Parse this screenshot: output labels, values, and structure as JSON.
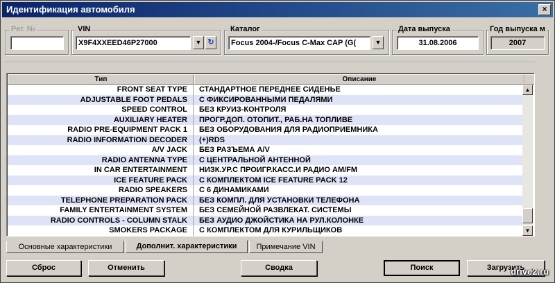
{
  "window": {
    "title": "Идентификация автомобиля",
    "close_symbol": "×"
  },
  "fields": {
    "reg_label": "Рег. №",
    "reg_value": "",
    "vin_label": "VIN",
    "vin_value": "X9F4XXEED46P27000",
    "catalog_label": "Каталог",
    "catalog_value": "Focus 2004-/Focus C-Max CAP (G(",
    "date_label": "Дата выпуска",
    "date_value": "31.08.2006",
    "year_label": "Год выпуска м",
    "year_value": "2007"
  },
  "grid": {
    "columns": [
      "Тип",
      "Описание"
    ],
    "rows": [
      [
        "FRONT SEAT TYPE",
        "СТАНДАРТНОЕ ПЕРЕДНЕЕ СИДЕНЬЕ"
      ],
      [
        "ADJUSTABLE FOOT PEDALS",
        "С ФИКСИРОВАННЫМИ ПЕДАЛЯМИ"
      ],
      [
        "SPEED CONTROL",
        "БЕЗ КРУИЗ-КОНТРОЛЯ"
      ],
      [
        "AUXILIARY HEATER",
        "ПРОГР.ДОП. ОТОПИТ., РАБ.НА ТОПЛИВЕ"
      ],
      [
        "RADIO PRE-EQUIPMENT PACK 1",
        "БЕЗ ОБОРУДОВАНИЯ ДЛЯ РАДИОПРИЕМНИКА"
      ],
      [
        "RADIO INFORMATION DECODER",
        "(+)RDS"
      ],
      [
        "A/V JACK",
        "БЕЗ РАЗЪЕМА A/V"
      ],
      [
        "RADIO ANTENNA TYPE",
        "С ЦЕНТРАЛЬНОЙ АНТЕННОЙ"
      ],
      [
        "IN CAR ENTERTAINMENT",
        "НИЗК.УР.С ПРОИГР.КАСС.И РАДИО AM/FM"
      ],
      [
        "ICE FEATURE PACK",
        "С КОМПЛЕКТОМ ICE FEATURE PACK 12"
      ],
      [
        "RADIO SPEAKERS",
        "С 6 ДИНАМИКАМИ"
      ],
      [
        "TELEPHONE PREPARATION PACK",
        "БЕЗ КОМПЛ. ДЛЯ УСТАНОВКИ ТЕЛЕФОНА"
      ],
      [
        "FAMILY ENTERTAINMENT SYSTEM",
        "БЕЗ СЕМЕЙНОЙ РАЗВЛЕКАТ. СИСТЕМЫ"
      ],
      [
        "RADIO CONTROLS - COLUMN STALK",
        "БЕЗ АУДИО ДЖОЙСТИКА НА РУЛ.КОЛОНКЕ"
      ],
      [
        "SMOKERS PACKAGE",
        "С КОМПЛЕКТОМ ДЛЯ КУРИЛЬЩИКОВ"
      ]
    ],
    "row_alt_color": "#dfe3f8"
  },
  "tabs": [
    {
      "label": "Основные характеристики",
      "active": false
    },
    {
      "label": "Дополнит. характеристики",
      "active": true
    },
    {
      "label": "Примечание VIN",
      "active": false
    }
  ],
  "buttons": {
    "reset": "Сброс",
    "cancel": "Отменить",
    "summary": "Сводка",
    "search": "Поиск",
    "load": "Загрузить"
  },
  "watermark": "drive2.ru",
  "icons": {
    "dropdown": "dropdown-arrow-icon",
    "refresh": "refresh-icon",
    "scroll_up": "scroll-up-icon",
    "scroll_down": "scroll-down-icon"
  },
  "colors": {
    "titlebar_start": "#0a246a",
    "titlebar_end": "#3a6ea5",
    "face": "#d4d0c8"
  }
}
